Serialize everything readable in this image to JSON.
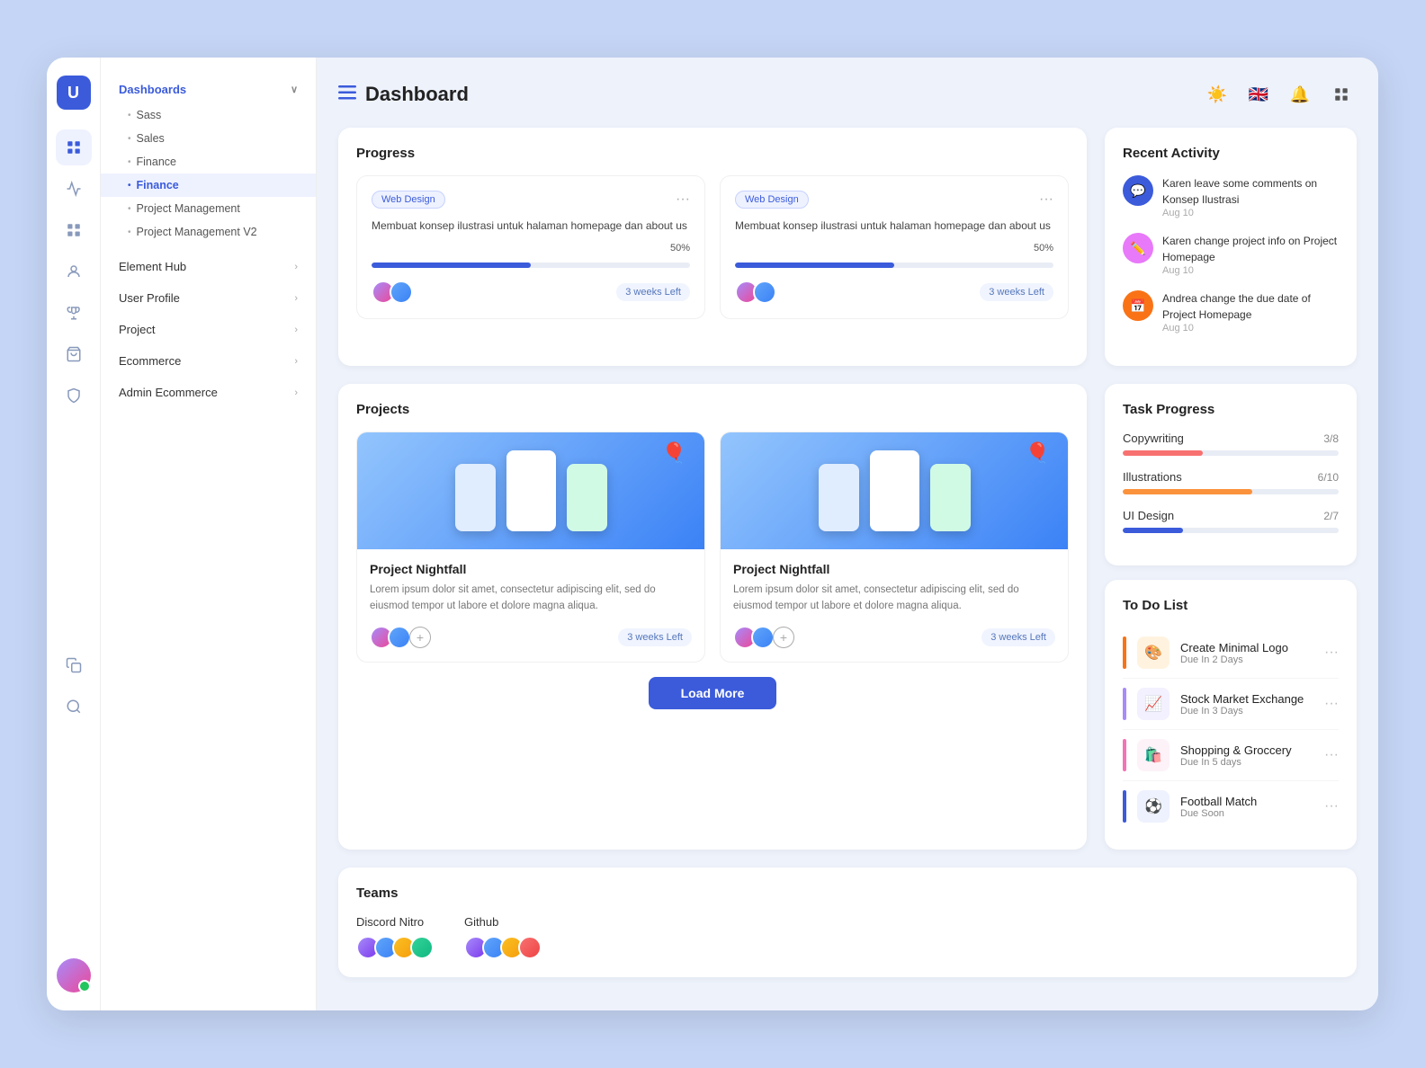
{
  "app": {
    "logo": "U",
    "title": "Dashboard",
    "subtitle": "Dashboard"
  },
  "sidebar": {
    "dashboards_label": "Dashboards",
    "sub_items": [
      {
        "label": "Sass",
        "active": false
      },
      {
        "label": "Sales",
        "active": false
      },
      {
        "label": "Finance",
        "active": false
      },
      {
        "label": "Finance",
        "active": true
      },
      {
        "label": "Project Management",
        "active": false
      },
      {
        "label": "Project Management V2",
        "active": false
      }
    ],
    "nav_items": [
      {
        "label": "Element Hub"
      },
      {
        "label": "User Profile"
      },
      {
        "label": "Project"
      },
      {
        "label": "Ecommerce"
      },
      {
        "label": "Admin Ecommerce"
      }
    ]
  },
  "progress": {
    "section_title": "Progress",
    "cards": [
      {
        "tag": "Web Design",
        "description": "Membuat konsep ilustrasi untuk halaman homepage dan about us",
        "percent": "50%",
        "percent_num": 50,
        "time": "3 weeks Left"
      },
      {
        "tag": "Web Design",
        "description": "Membuat konsep ilustrasi untuk halaman homepage dan about us",
        "percent": "50%",
        "percent_num": 50,
        "time": "3 weeks Left"
      }
    ]
  },
  "projects": {
    "section_title": "Projects",
    "cards": [
      {
        "title": "Project Nightfall",
        "description": "Lorem ipsum dolor sit amet, consectetur adipiscing elit, sed do eiusmod tempor ut labore et dolore magna aliqua.",
        "time": "3 weeks Left"
      },
      {
        "title": "Project Nightfall",
        "description": "Lorem ipsum dolor sit amet, consectetur adipiscing elit, sed do eiusmod tempor ut labore et dolore magna aliqua.",
        "time": "3 weeks Left"
      }
    ],
    "load_more": "Load More"
  },
  "teams": {
    "section_title": "Teams",
    "items": [
      {
        "name": "Discord Nitro"
      },
      {
        "name": "Github"
      }
    ]
  },
  "recent_activity": {
    "section_title": "Recent Activity",
    "items": [
      {
        "text": "Karen leave some comments on Konsep Ilustrasi",
        "time": "Aug 10",
        "color": "#3b5bdb",
        "icon": "💬"
      },
      {
        "text": "Karen change project info on Project Homepage",
        "time": "Aug 10",
        "color": "#e879f9",
        "icon": "✏️"
      },
      {
        "text": "Andrea change the due date of Project Homepage",
        "time": "Aug 10",
        "color": "#f97316",
        "icon": "📅"
      }
    ]
  },
  "task_progress": {
    "section_title": "Task Progress",
    "tasks": [
      {
        "name": "Copywriting",
        "count": "3/8",
        "percent": 37,
        "color": "#f87171"
      },
      {
        "name": "Illustrations",
        "count": "6/10",
        "percent": 60,
        "color": "#fb923c"
      },
      {
        "name": "UI Design",
        "count": "2/7",
        "percent": 28,
        "color": "#3b5bdb"
      }
    ]
  },
  "todo": {
    "section_title": "To Do List",
    "items": [
      {
        "title": "Create Minimal Logo",
        "due": "Due In 2 Days",
        "bar_color": "#f97316",
        "bg_color": "#fff3e0",
        "icon": "🎨"
      },
      {
        "title": "Stock Market Exchange",
        "due": "Due In 3 Days",
        "bar_color": "#a78bfa",
        "bg_color": "#f3f0ff",
        "icon": "📈"
      },
      {
        "title": "Shopping & Groccery",
        "due": "Due In 5 days",
        "bar_color": "#f472b6",
        "bg_color": "#fdf2f8",
        "icon": "🛍️"
      },
      {
        "title": "Football Match",
        "due": "Due Soon",
        "bar_color": "#3b5bdb",
        "bg_color": "#eef2ff",
        "icon": "⚽"
      }
    ]
  },
  "icons": {
    "hamburger": "☰",
    "sun": "☀️",
    "flag": "🇬🇧",
    "bell": "🔔",
    "grid": "⊞",
    "activity": "〜",
    "dashboard": "⊞",
    "person": "👤",
    "trophy": "🏆",
    "bag": "🛍",
    "shield": "🛡",
    "copy": "📋",
    "search": "🔍",
    "chevron_right": "›",
    "chevron_down": "›",
    "more": "···"
  }
}
